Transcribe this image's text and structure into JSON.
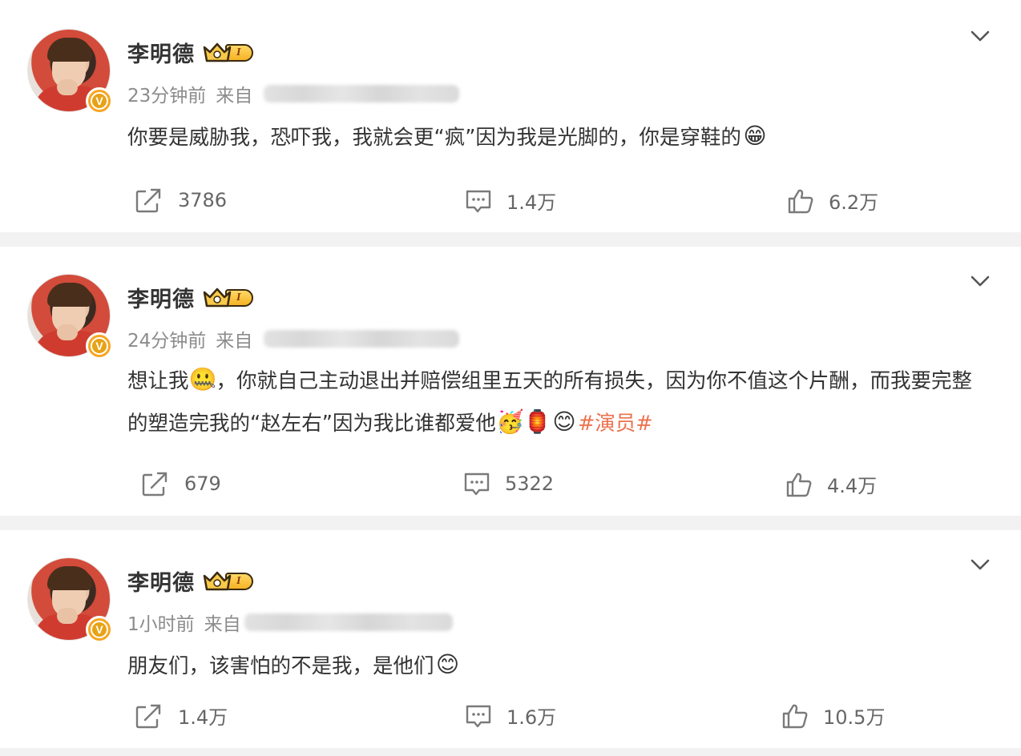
{
  "posts": [
    {
      "username": "李明德",
      "vip_level": "I",
      "time": "23分钟前",
      "from_label": "来自",
      "content_text": "你要是威胁我，恐吓我，我就会更“疯”因为我是光脚的，你是穿鞋的",
      "emojis": [
        "😁"
      ],
      "repost_count": "3786",
      "comment_count": "1.4万",
      "like_count": "6.2万"
    },
    {
      "username": "李明德",
      "vip_level": "I",
      "time": "24分钟前",
      "from_label": "来自",
      "content_part1": "想让我",
      "content_part2": "，你就自己主动退出并赔偿组里五天的所有损失，因为你不值这个片酬，而我要完整的塑造完我的“赵左右”因为我比谁都爱他",
      "hashtag": "#演员#",
      "emojis": [
        "🤐",
        "🥳",
        "🏮",
        "😊"
      ],
      "repost_count": "679",
      "comment_count": "5322",
      "like_count": "4.4万"
    },
    {
      "username": "李明德",
      "vip_level": "I",
      "time": "1小时前",
      "from_label": "来自",
      "content_text": "朋友们，该害怕的不是我，是他们",
      "emojis": [
        "😊"
      ],
      "repost_count": "1.4万",
      "comment_count": "1.6万",
      "like_count": "10.5万"
    }
  ],
  "colors": {
    "background": "#f2f2f2",
    "card": "#ffffff",
    "text": "#333333",
    "meta": "#8c8c8c",
    "action": "#666666",
    "hashtag": "#eb7350",
    "verified_badge": "#f6a623"
  },
  "icons": [
    "chevron-down-icon",
    "repost-icon",
    "comment-icon",
    "like-icon",
    "verified-v-icon",
    "vip-crown-icon"
  ]
}
